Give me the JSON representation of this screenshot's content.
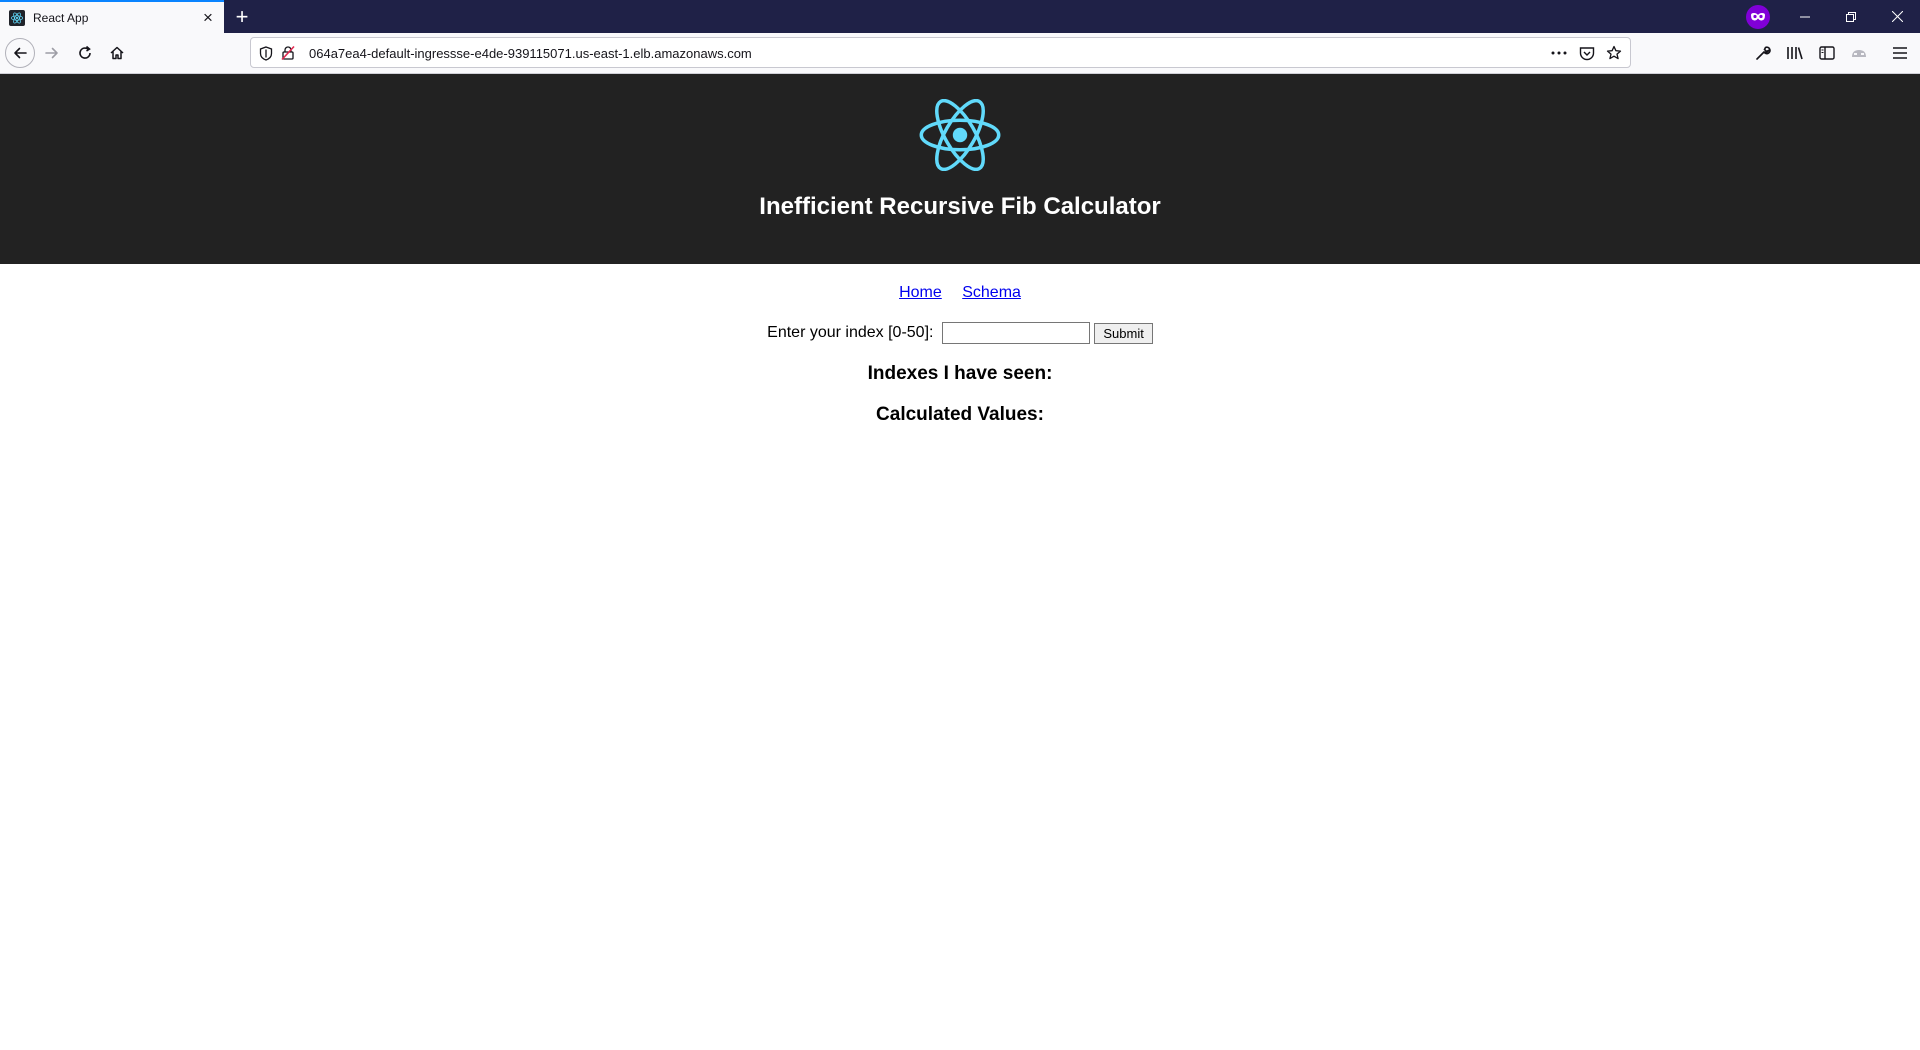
{
  "browser": {
    "tab_title": "React App",
    "url": "064a7ea4-default-ingressse-e4de-939115071.us-east-1.elb.amazonaws.com",
    "icons": [
      "react-favicon",
      "close-icon",
      "plus-icon",
      "private-browsing-icon",
      "minimize-icon",
      "restore-icon",
      "close-window-icon",
      "back-icon",
      "forward-icon",
      "reload-icon",
      "home-icon",
      "shield-icon",
      "insecure-lock-icon",
      "more-icon",
      "pocket-icon",
      "star-icon",
      "wrench-icon",
      "library-icon",
      "sidebar-icon",
      "account-icon",
      "menu-icon"
    ]
  },
  "header": {
    "title": "Inefficient Recursive Fib Calculator",
    "logo_color": "#61dafb",
    "background": "#222222"
  },
  "nav": {
    "home": "Home",
    "schema": "Schema"
  },
  "form": {
    "label": "Enter your index [0-50]:",
    "input_value": "",
    "submit_label": "Submit"
  },
  "sections": {
    "indexes_heading": "Indexes I have seen:",
    "values_heading": "Calculated Values:"
  }
}
